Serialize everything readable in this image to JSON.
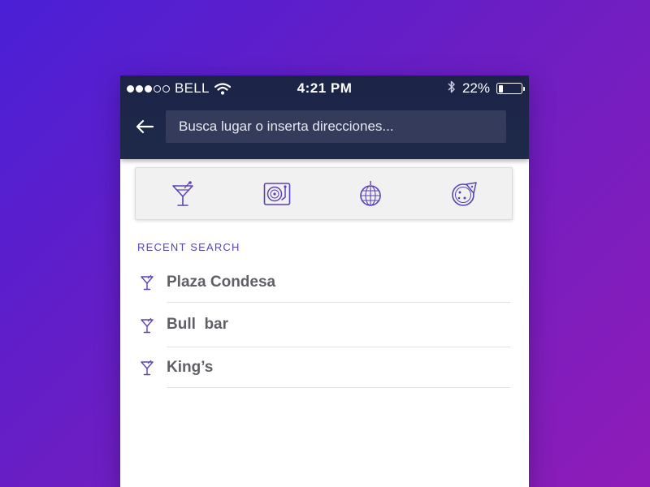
{
  "colors": {
    "accent": "#5a43b8",
    "header_bg": "#1e2a4a",
    "background_start": "#4a1fd6",
    "background_end": "#8f1cb8"
  },
  "status_bar": {
    "signal_dots_filled": 3,
    "signal_dots_total": 5,
    "carrier": "BELL",
    "wifi_icon": "wifi-icon",
    "time": "4:21 PM",
    "bluetooth_icon": "bluetooth-icon",
    "battery_percent": "22%",
    "battery_level": 0.22
  },
  "search": {
    "back_icon": "arrow-left-icon",
    "placeholder": "Busca lugar o inserta direcciones..."
  },
  "categories": [
    {
      "icon": "cocktail-icon"
    },
    {
      "icon": "turntable-icon"
    },
    {
      "icon": "disco-ball-icon"
    },
    {
      "icon": "pizza-icon"
    }
  ],
  "recent": {
    "title": "RECENT SEARCH",
    "items": [
      {
        "icon": "cocktail-icon",
        "label": "Plaza Condesa"
      },
      {
        "icon": "cocktail-icon",
        "label": "Bull  bar"
      },
      {
        "icon": "cocktail-icon",
        "label": "King’s"
      }
    ]
  }
}
